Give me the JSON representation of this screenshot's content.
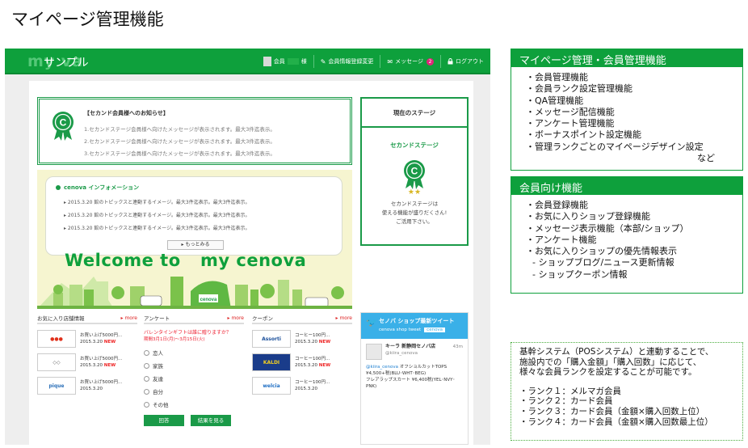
{
  "page_title": "マイページ管理機能",
  "mock": {
    "logo_ghost": "my   va",
    "logo_text": "サンプル",
    "nav": {
      "member_prefix": "会員",
      "member_suffix": "様",
      "edit_profile": "会員情報登録変更",
      "messages": "メッセージ",
      "message_count": "2",
      "logout": "ログアウト"
    },
    "notice": {
      "title": "【セカンド会員様へのお知らせ】",
      "lines": [
        "1.セカンドステージ会員様へ向けたメッセージが表示されます。最大3件迄表示。",
        "2.セカンドステージ会員様へ向けたメッセージが表示されます。最大3件迄表示。",
        "3.セカンドステージ会員様へ向けたメッセージが表示されます。最大3件迄表示。"
      ]
    },
    "stage": {
      "header": "現在のステージ",
      "name": "セカンドステージ",
      "stars": "★★",
      "desc": [
        "セカンドステージは",
        "使える機能が盛りだくさん!",
        "ご活用下さい。"
      ]
    },
    "info": {
      "title": "cenova インフォメーション",
      "lines": [
        "2015.3.20 館のトピックスと連動するイメージ。最大3件迄表示。最大3件迄表示。",
        "2015.3.20 館のトピックスと連動するイメージ。最大3件迄表示。最大3件迄表示。",
        "2015.3.20 館のトピックスと連動するイメージ。最大3件迄表示。最大3件迄表示。"
      ],
      "more": "もっとみる"
    },
    "welcome": {
      "left": "Welcome to",
      "right": "my cenova",
      "sign": "cenova"
    },
    "favorites": {
      "header": "お気に入り店舗情報",
      "more": "more",
      "items": [
        {
          "logo": "●●●",
          "text": "お買い上げ5000円...",
          "date": "2015.3.20",
          "badge": "NEW"
        },
        {
          "logo": "◇◇",
          "text": "お買い上げ5000円...",
          "date": "2015.3.20",
          "badge": "NEW"
        },
        {
          "logo": "pique",
          "text": "お買い上げ5000円...",
          "date": "2015.3.20",
          "badge": ""
        }
      ]
    },
    "survey": {
      "header": "アンケート",
      "more": "more",
      "question_1": "バレンタインギフトは誰に贈りますか？",
      "question_2": "期間3月1日(月)〜3月15日(火)",
      "options": [
        "恋人",
        "家族",
        "友達",
        "自分",
        "その他"
      ],
      "answer_button": "回答",
      "results_button": "結果を見る"
    },
    "coupons": {
      "header": "クーポン",
      "more": "more",
      "items": [
        {
          "logo": "Assorti",
          "text": "コーヒー100円...",
          "date": "2015.3.20",
          "badge": "NEW"
        },
        {
          "logo": "KALDI",
          "text": "コーヒー100円...",
          "date": "2015.3.20",
          "badge": "NEW"
        },
        {
          "logo": "welcia",
          "text": "コーヒー100円...",
          "date": "2015.3.20",
          "badge": ""
        }
      ]
    },
    "tweet": {
      "title": "セノバ ショップ最新ツイート",
      "subtitle": "cenova shop tweet",
      "tag": "cenova",
      "user": "キーラ 新静岡セノバ店",
      "handle": "@kiira_cenova",
      "time": "43m",
      "link": "@kiira_cenova",
      "text_1": " オフショルカットTOPS",
      "text_2": "¥4,500+税(BLU･WHT･BEG)",
      "text_3": "フレアラップスカート ¥6,400税(YEL･NVY･PNK)"
    }
  },
  "panel_mypage": {
    "title": "マイページ管理・会員管理機能",
    "items": [
      "・会員管理機能",
      "・会員ランク設定管理機能",
      "・QA管理機能",
      "・メッセージ配信機能",
      "・アンケート管理機能",
      "・ボーナスポイント設定機能",
      "・管理ランクごとのマイページデザイン設定",
      "など"
    ]
  },
  "panel_member": {
    "title": "会員向け機能",
    "items": [
      "・会員登録機能",
      "・お気に入りショップ登録機能",
      "・メッセージ表示機能（本部/ショップ）",
      "・アンケート機能",
      "・お気に入りショップの優先情報表示",
      "- ショップブログ/ニュース更新情報",
      "- ショップクーポン情報"
    ]
  },
  "note": {
    "lines": [
      "基幹システム（POSシステム）と連動することで、",
      "施設内での「購入金額」「購入回数」に応じて、",
      "様々な会員ランクを設定することが可能です。"
    ],
    "ranks": [
      "・ランク１：メルマガ会員",
      "・ランク２：カード会員",
      "・ランク３：カード会員（金額×購入回数上位）",
      "・ランク４：カード会員（金額×購入回数最上位）"
    ]
  },
  "colors": {
    "brand_green": "#0ea03c",
    "badge_pink": "#e0257a",
    "twitter_blue": "#3ab0e8"
  }
}
